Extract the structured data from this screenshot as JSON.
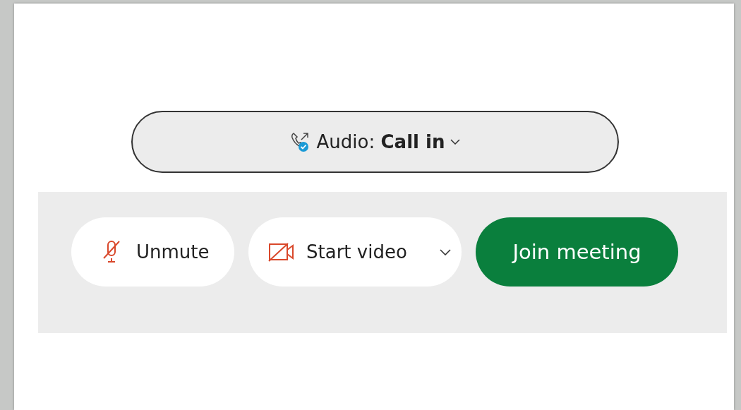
{
  "audio_button": {
    "label": "Audio: **Call in**"
  },
  "controls": [
    {
      "kind": "mic",
      "label": "Unmute"
    },
    {
      "kind": "video",
      "label": "Start video"
    },
    {
      "kind": "join",
      "label": "Join meeting"
    }
  ]
}
